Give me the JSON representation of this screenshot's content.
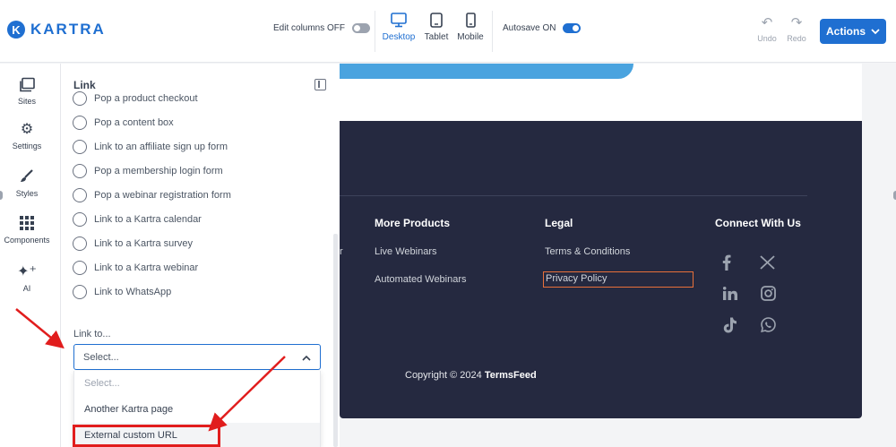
{
  "topbar": {
    "logo_text": "KARTRA",
    "logo_letter": "K",
    "edit_columns_label": "Edit columns OFF",
    "devices": [
      {
        "label": "Desktop",
        "icon": "desktop-icon",
        "active": true
      },
      {
        "label": "Tablet",
        "icon": "tablet-icon",
        "active": false
      },
      {
        "label": "Mobile",
        "icon": "mobile-icon",
        "active": false
      }
    ],
    "autosave_label": "Autosave ON",
    "undo_label": "Undo",
    "redo_label": "Redo",
    "actions_label": "Actions"
  },
  "rail": {
    "items": [
      {
        "label": "Sites",
        "icon": "sites-icon"
      },
      {
        "label": "Settings",
        "icon": "gear-icon"
      },
      {
        "label": "Styles",
        "icon": "brush-icon"
      },
      {
        "label": "Components",
        "icon": "grid-icon"
      },
      {
        "label": "AI",
        "icon": "sparkle-icon"
      }
    ]
  },
  "panel": {
    "title": "Link",
    "options": [
      "Pop a product checkout",
      "Pop a content box",
      "Link to an affiliate sign up form",
      "Pop a membership login form",
      "Pop a webinar registration form",
      "Link to a Kartra calendar",
      "Link to a Kartra survey",
      "Link to a Kartra webinar",
      "Link to WhatsApp"
    ],
    "link_to_label": "Link to...",
    "select_value": "Select...",
    "dropdown_options": [
      "Select...",
      "Another Kartra page",
      "External custom URL"
    ]
  },
  "footer": {
    "cut_link": "r",
    "more_products_title": "More Products",
    "more_products_links": [
      "Live Webinars",
      "Automated Webinars"
    ],
    "legal_title": "Legal",
    "legal_links": [
      "Terms & Conditions",
      "Privacy Policy"
    ],
    "connect_title": "Connect With Us",
    "social_icons": [
      "facebook-icon",
      "x-icon",
      "linkedin-icon",
      "instagram-icon",
      "tiktok-icon",
      "whatsapp-icon"
    ],
    "copyright_prefix": "Copyright © 2024",
    "copyright_brand": "TermsFeed"
  },
  "colors": {
    "accent": "#1f6fd1",
    "footer_bg": "#252940",
    "annotation": "#e11d1d",
    "highlight_border": "#e8703a"
  }
}
